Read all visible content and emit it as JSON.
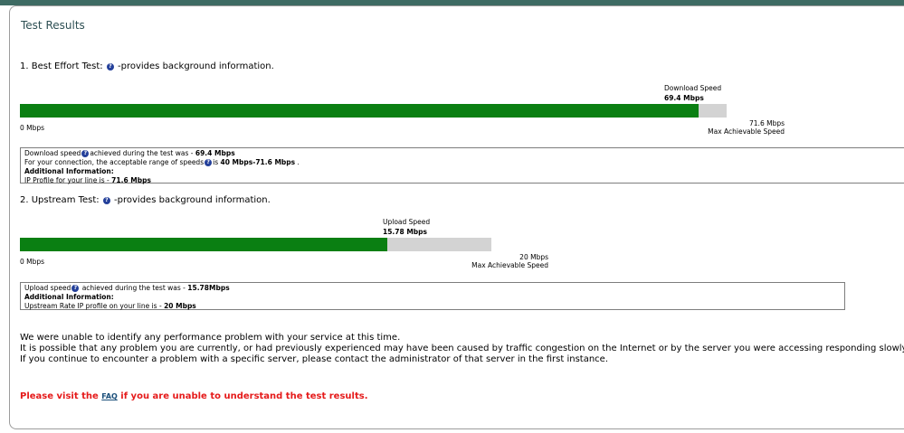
{
  "page": {
    "title": "Test Results"
  },
  "best_effort": {
    "heading": "1. Best Effort Test:",
    "heading_suffix": "-provides background information.",
    "speed_label": "Download Speed",
    "speed_value": "69.4 Mbps",
    "fill_fraction": 0.9609,
    "min_label": "0 Mbps",
    "max_value": "71.6 Mbps",
    "max_label": "Max Achievable Speed",
    "info": {
      "line1_prefix": "Download speed",
      "line1_mid": "achieved during the test was - ",
      "line1_value": "69.4 Mbps",
      "line2_prefix": "For your connection, the acceptable range of speeds",
      "line2_mid": "is ",
      "line2_value": "40 Mbps-71.6 Mbps",
      "line2_suffix": " .",
      "additional_label": "Additional Information:",
      "line4_prefix": "IP Profile for your line is - ",
      "line4_value": "71.6 Mbps"
    }
  },
  "upstream": {
    "heading": "2. Upstream Test:",
    "heading_suffix": "-provides background information.",
    "speed_label": "Upload Speed",
    "speed_value": "15.78 Mbps",
    "fill_fraction": 0.7788,
    "min_label": "0 Mbps",
    "max_value": "20 Mbps",
    "max_label": "Max Achievable Speed",
    "info": {
      "line1_prefix": "Upload speed",
      "line1_mid": " achieved during the test was - ",
      "line1_value": "15.78Mbps",
      "additional_label": "Additional Information:",
      "line3_prefix": "Upstream Rate IP profile on your line is - ",
      "line3_value": "20 Mbps"
    }
  },
  "messages": [
    "We were unable to identify any performance problem with your service at this time.",
    "It is possible that any problem you are currently, or had previously experienced may have been caused by traffic congestion on the Internet or by the server you were accessing responding slowly.",
    "If you continue to encounter a problem with a specific server, please contact the administrator of that server in the first instance."
  ],
  "faq": {
    "prefix": "Please visit the ",
    "link": "FAQ",
    "suffix": " if you are unable to understand the test results."
  },
  "help_icon": "question-mark-icon",
  "colors": {
    "bar_fill": "#0a7f12",
    "bar_track": "#d3d3d3",
    "title": "#2d4f53",
    "faq": "#e51a1a",
    "topbar": "#3e6b63"
  }
}
